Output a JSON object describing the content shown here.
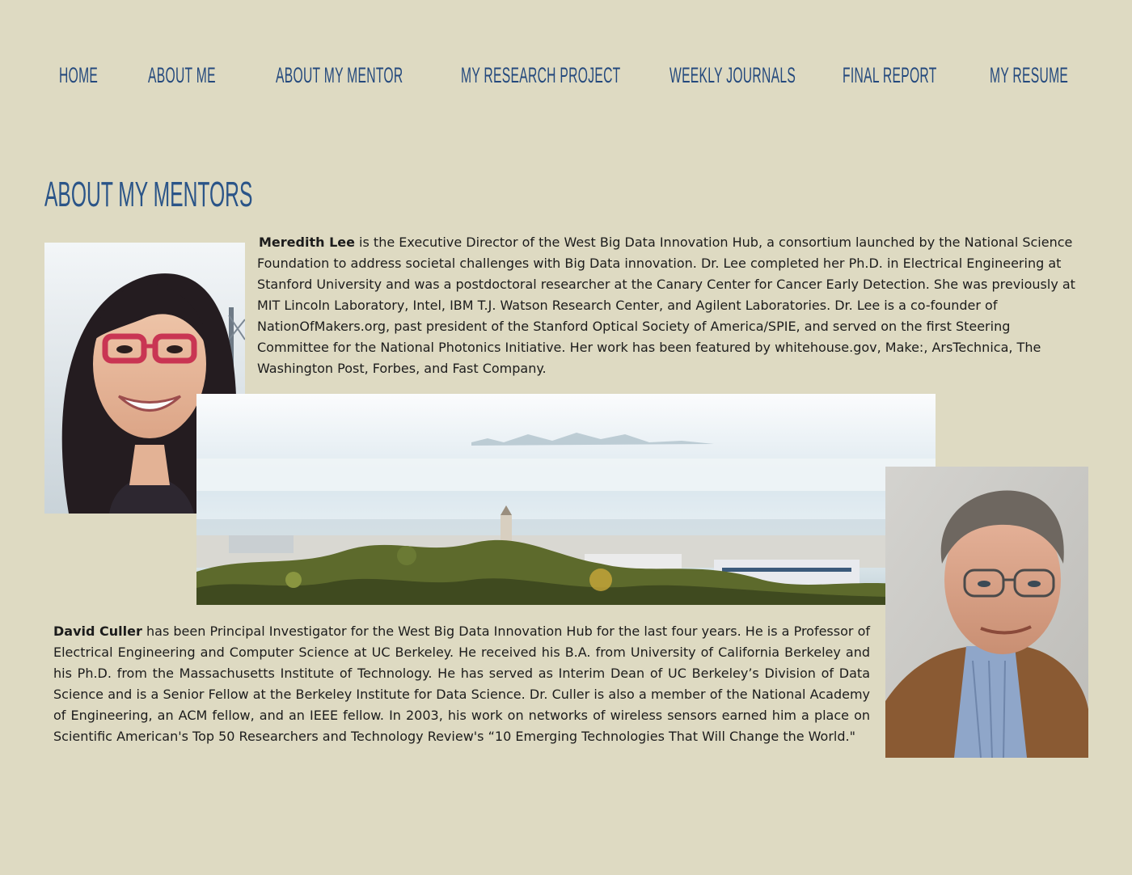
{
  "nav": {
    "items": [
      {
        "label": "Home"
      },
      {
        "label": "About Me"
      },
      {
        "label": "About My Mentor"
      },
      {
        "label": "My Research Project"
      },
      {
        "label": "Weekly Journals"
      },
      {
        "label": "Final Report"
      },
      {
        "label": "My Resume"
      }
    ]
  },
  "page": {
    "title": "About My Mentors"
  },
  "mentors": [
    {
      "name": "Meredith Lee",
      "bio": " is the Executive Director of the West Big Data Innovation Hub, a consortium launched by the National Science Foundation to address societal challenges with Big Data innovation.  Dr. Lee completed her Ph.D. in Electrical Engineering at Stanford University and was a postdoctoral researcher at the Canary Center for Cancer Early Detection. She was previously at MIT Lincoln Laboratory, Intel, IBM T.J. Watson Research Center, and Agilent Laboratories. Dr. Lee is a co-founder of NationOfMakers.org, past president of the Stanford Optical Society of America/SPIE, and served on the first  Steering Committee for the National Photonics Initiative. Her work has been featured by whitehouse.gov, Make:, ArsTechnica, The Washington Post, Forbes, and Fast Company."
    },
    {
      "name": "David Culler",
      "bio": " has been Principal Investigator for the West Big Data Innovation Hub for the last four years. He is a Professor of Electrical Engineering and Computer Science at UC Berkeley.  He received his B.A. from University of California Berkeley and his Ph.D. from the Massachusetts Institute of Technology.  He has served as Interim Dean of UC Berkeley’s Division of Data Science and is a Senior Fellow at the Berkeley Institute for Data Science.  Dr. Culler  is also a member of the National Academy of Engineering, an ACM fellow, and an IEEE fellow. In 2003, his work on networks of wireless sensors earned him a place on Scientific American's Top 50 Researchers and Technology Review's “10 Emerging Technologies That Will Change the World.\""
    }
  ],
  "colors": {
    "background": "#dedac2",
    "nav_text": "#24497d",
    "title_text": "#2a5488",
    "body_text": "#1c1c1c"
  }
}
